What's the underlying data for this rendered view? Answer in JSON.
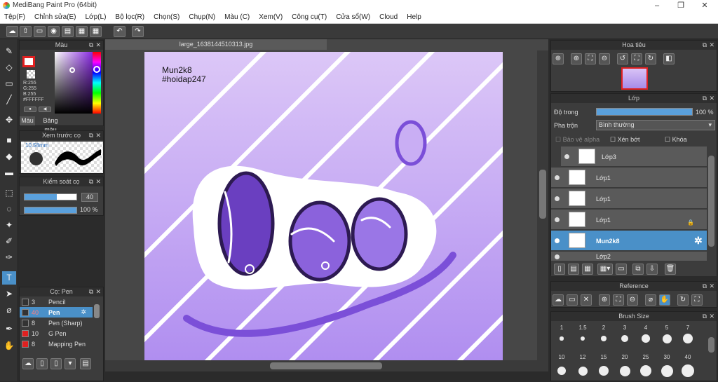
{
  "window": {
    "title": "MediBang Paint Pro (64bit)",
    "min": "–",
    "max": "❐",
    "close": "✕"
  },
  "menu": [
    "Tệp(F)",
    "Chỉnh sửa(E)",
    "Lớp(L)",
    "Bộ lọc(R)",
    "Chọn(S)",
    "Chụp(N)",
    "Màu (C)",
    "Xem(V)",
    "Công cụ(T)",
    "Cửa sổ(W)",
    "Cloud",
    "Help"
  ],
  "color_panel": {
    "title": "Màu",
    "r": "R:255",
    "g": "G:255",
    "b": "B:255",
    "hex": "#FFFFFF",
    "tab1": "Màu",
    "tab2": "Bảng màu"
  },
  "preview_panel": {
    "title": "Xem trước cọ",
    "size": "10.58mm"
  },
  "brush_control": {
    "title": "Kiểm soát cọ",
    "size_value": "40",
    "size_fill": 0.62,
    "opacity_value": "100 %",
    "opacity_fill": 1.0
  },
  "pens_panel": {
    "title": "Cọ: Pen",
    "items": [
      {
        "num": "3",
        "name": "Pencil",
        "color": "#333333"
      },
      {
        "num": "40",
        "name": "Pen",
        "color": "#333333",
        "selected": true
      },
      {
        "num": "8",
        "name": "Pen (Sharp)",
        "color": "#333333"
      },
      {
        "num": "10",
        "name": "G Pen",
        "color": "#e02020"
      },
      {
        "num": "8",
        "name": "Mapping Pen",
        "color": "#e02020"
      }
    ]
  },
  "canvas": {
    "tab": "large_1638144510313.jpg",
    "text1": "Mun2k8",
    "text2": "#hoidap247"
  },
  "navigator": {
    "title": "Hoa tiêu"
  },
  "layers_panel": {
    "title": "Lớp",
    "opacity_label": "Độ trong",
    "opacity_value": "100 %",
    "opacity_fill": 1.0,
    "blend_label": "Pha trộn",
    "blend_value": "Bình thường",
    "alpha_label": "Bảo vệ alpha",
    "clip_label": "Xén bớt",
    "lock_label": "Khóa",
    "layers": [
      {
        "name": "Lớp3"
      },
      {
        "name": "Lớp1"
      },
      {
        "name": "Lớp1"
      },
      {
        "name": "Lớp1"
      },
      {
        "name": "Mun2k8",
        "selected": true
      },
      {
        "name": "Lớp2"
      }
    ]
  },
  "reference_panel": {
    "title": "Reference"
  },
  "brush_size_panel": {
    "title": "Brush Size",
    "row1": [
      "1",
      "1.5",
      "2",
      "3",
      "4",
      "5",
      "7"
    ],
    "row2": [
      "10",
      "12",
      "15",
      "20",
      "25",
      "30",
      "40"
    ]
  },
  "colors": {
    "accent": "#4a90c8",
    "canvas_top": "#dcc7f7",
    "canvas_bottom": "#b08ef0"
  }
}
